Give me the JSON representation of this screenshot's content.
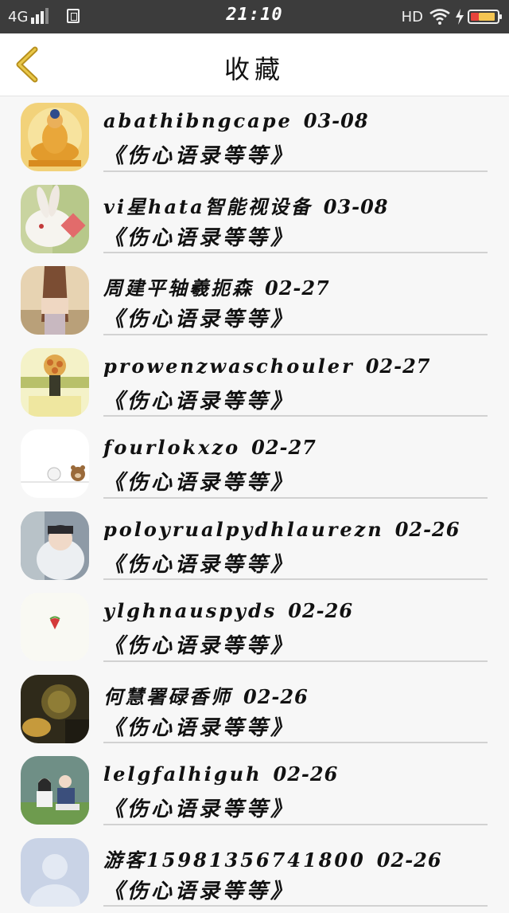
{
  "status_bar": {
    "network": "4G",
    "time": "21:10",
    "hd": "HD",
    "colors": {
      "background": "#3c3c3c",
      "battery_low": "#e8453c",
      "battery_mid": "#f4c552"
    }
  },
  "header": {
    "title": "收藏",
    "back_icon": "chevron-left-icon",
    "back_color": "#b78f1c"
  },
  "items": [
    {
      "name": "abathibngcape",
      "date": "03-08",
      "subtitle": "《伤心语录等等》",
      "avatar": "buddha"
    },
    {
      "name": "vi星hata智能视设备",
      "date": "03-08",
      "subtitle": "《伤心语录等等》",
      "avatar": "rabbit"
    },
    {
      "name": "周建平轴羲扼森",
      "date": "02-27",
      "subtitle": "《伤心语录等等》",
      "avatar": "girl-field"
    },
    {
      "name": "prowenzwaschouler",
      "date": "02-27",
      "subtitle": "《伤心语录等等》",
      "avatar": "flowers"
    },
    {
      "name": "fourlokxzo",
      "date": "02-27",
      "subtitle": "《伤心语录等等》",
      "avatar": "bear"
    },
    {
      "name": "poloyrualpydhlaurezn",
      "date": "02-26",
      "subtitle": "《伤心语录等等》",
      "avatar": "boy"
    },
    {
      "name": "ylghnauspyds",
      "date": "02-26",
      "subtitle": "《伤心语录等等》",
      "avatar": "strawberry"
    },
    {
      "name": "何慧署碌香师",
      "date": "02-26",
      "subtitle": "《伤心语录等等》",
      "avatar": "dark"
    },
    {
      "name": "lelgfalhiguh",
      "date": "02-26",
      "subtitle": "《伤心语录等等》",
      "avatar": "couple"
    },
    {
      "name": "游客15981356741800",
      "date": "02-26",
      "subtitle": "《伤心语录等等》",
      "avatar": "default"
    }
  ]
}
